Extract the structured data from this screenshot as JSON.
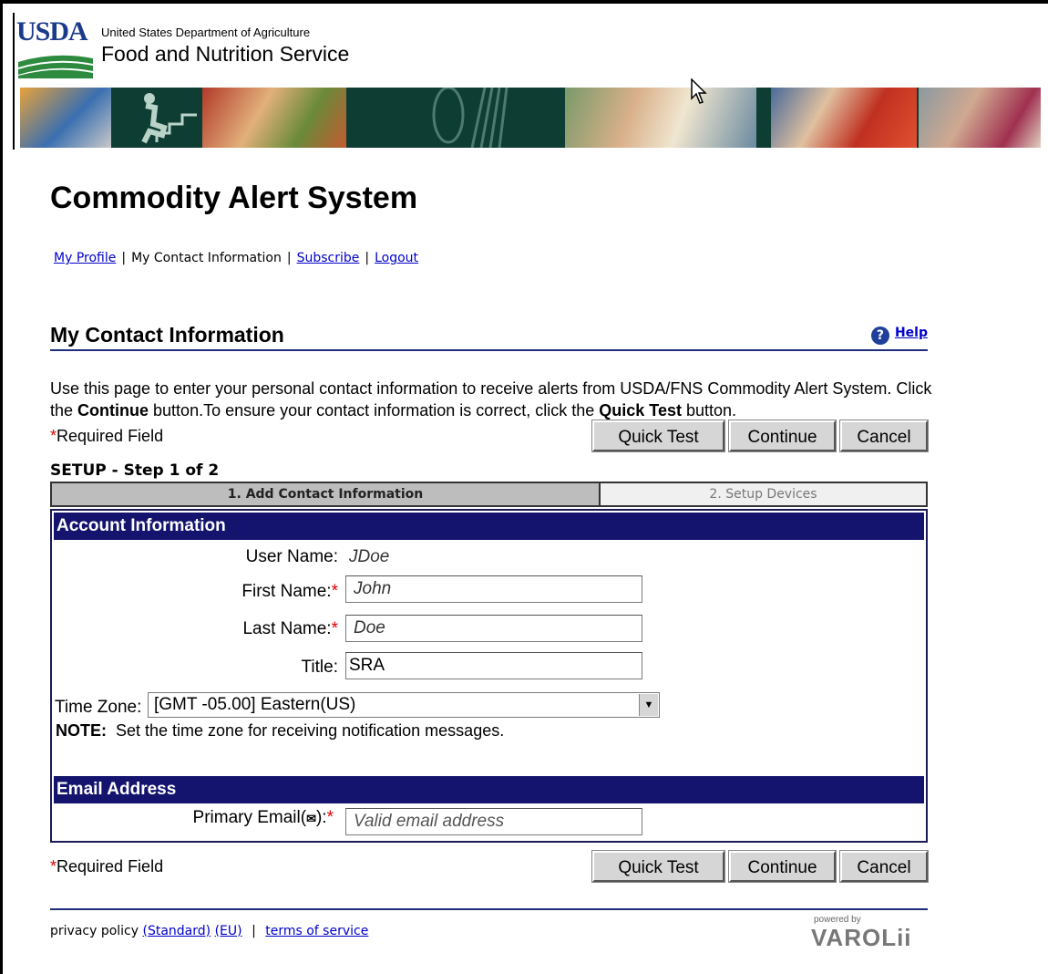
{
  "header": {
    "logo_text": "USDA",
    "agency_line1": "United States Department of Agriculture",
    "agency_line2": "Food and Nutrition Service"
  },
  "page_title": "Commodity Alert System",
  "top_nav": {
    "my_profile": "My Profile",
    "my_contact_information": "My Contact Information",
    "subscribe": "Subscribe",
    "logout": "Logout",
    "separator": "|"
  },
  "section": {
    "title": "My Contact Information",
    "help_label": "Help"
  },
  "intro": {
    "part1": "Use this page to enter your personal contact information to receive alerts from USDA/FNS Commodity Alert System. Click the ",
    "continue_word": "Continue",
    "part2": " button.To ensure your contact information is correct, click the ",
    "quick_test_word": "Quick Test",
    "part3": " button."
  },
  "required": {
    "star": "*",
    "label": "Required Field"
  },
  "buttons": {
    "quick_test": "Quick Test",
    "continue": "Continue",
    "cancel": "Cancel"
  },
  "setup": {
    "label": "SETUP - Step 1 of 2",
    "step1": "1. Add Contact Information",
    "step2": "2. Setup Devices"
  },
  "account": {
    "header": "Account Information",
    "user_name_label": "User Name:",
    "user_name_value": "JDoe",
    "first_name_label": "First Name:",
    "first_name_value": "John",
    "last_name_label": "Last Name:",
    "last_name_value": "Doe",
    "title_label": "Title:",
    "title_value": "SRA",
    "time_zone_label": "Time Zone:",
    "time_zone_value": "[GMT -05.00] Eastern(US)",
    "note_bold": "NOTE:",
    "note_text": "  Set the time zone for receiving notification messages."
  },
  "email": {
    "header": "Email Address",
    "primary_label": "Primary Email(",
    "primary_label_end": "):",
    "primary_placeholder": "Valid email address"
  },
  "footer": {
    "privacy_policy": "privacy policy",
    "standard": "(Standard)",
    "eu": "(EU)",
    "separator": "|",
    "terms": "terms of service",
    "powered_by": "powered by",
    "brand": "VAROLii"
  },
  "colors": {
    "section_bar": "#14146e",
    "link": "#0000cc",
    "required_star": "#e00000",
    "banner": "#0e3d34"
  }
}
